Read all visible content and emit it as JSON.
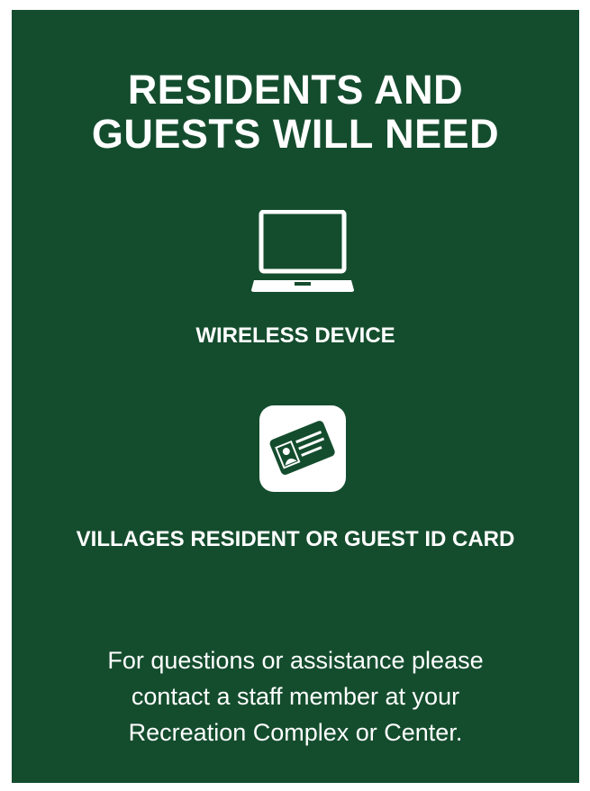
{
  "heading": {
    "line1": "RESIDENTS AND",
    "line2": "GUESTS WILL NEED"
  },
  "items": [
    {
      "icon": "laptop-icon",
      "label": "WIRELESS DEVICE"
    },
    {
      "icon": "id-card-icon",
      "label": "VILLAGES RESIDENT OR GUEST ID CARD"
    }
  ],
  "footer": {
    "line1": "For questions or assistance please",
    "line2": "contact a staff member at your",
    "line3": "Recreation Complex or Center."
  },
  "colors": {
    "background": "#144d2e",
    "text": "#ffffff"
  }
}
